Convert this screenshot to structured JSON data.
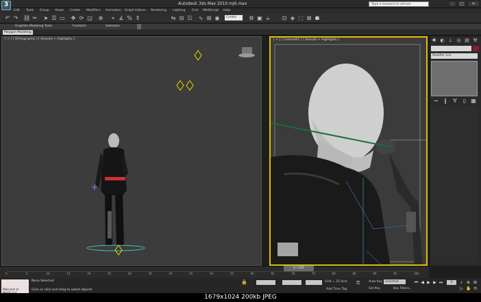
{
  "window": {
    "title": "Autodesk 3ds Max 2010   mj6.max",
    "search_placeholder": "Type a keyword or phrase"
  },
  "menu": [
    "Edit",
    "Tools",
    "Group",
    "Views",
    "Create",
    "Modifiers",
    "Animation",
    "Graph Editors",
    "Rendering",
    "Lighting",
    "Civil",
    "MAXScript",
    "Help"
  ],
  "toolbar": {
    "selection_set": "Create Selection Se"
  },
  "ribbon": {
    "tabs": [
      "Graphite Modeling Tools",
      "Freeform",
      "Selection"
    ],
    "active_panel": "Polygon Modeling"
  },
  "viewports": {
    "left_label": "[ + ] [ Orthographic ] [ Smooth + Highlights ]",
    "right_label": "[ + ] [ Camera01 ] [ Smooth + Highlights ]"
  },
  "command_panel": {
    "modifier_list": "Modifier List",
    "name_color": "#8b1a2a"
  },
  "timeline": {
    "frame_display": "0 / 100",
    "ticks": [
      "0",
      "5",
      "10",
      "15",
      "20",
      "25",
      "30",
      "35",
      "40",
      "45",
      "50",
      "55",
      "60",
      "65",
      "70",
      "75",
      "80",
      "85",
      "90",
      "95",
      "100"
    ]
  },
  "status": {
    "welcome": "Welcome to MAXScript.",
    "selection": "None Selected",
    "prompt": "Click or click-and-drag to select objects",
    "grid": "Grid = 25.4cm",
    "auto_key": "Auto Key",
    "set_key": "Set Key",
    "key_mode": "Selected",
    "key_filters": "Key Filters...",
    "add_time_tag": "Add Time Tag",
    "frame": "0"
  },
  "caption": "1679x1024  200kb  JPEG"
}
